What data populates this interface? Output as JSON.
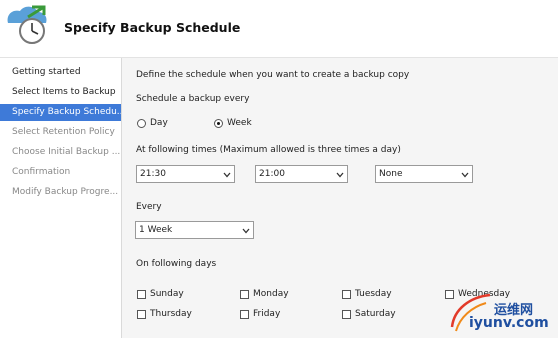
{
  "header": {
    "title": "Specify Backup Schedule"
  },
  "sidebar": {
    "items": [
      {
        "label": "Getting started",
        "state": "normal"
      },
      {
        "label": "Select Items to Backup",
        "state": "normal"
      },
      {
        "label": "Specify Backup Schedu...",
        "state": "active"
      },
      {
        "label": "Select Retention Policy",
        "state": "disabled"
      },
      {
        "label": "Choose Initial Backup ...",
        "state": "disabled"
      },
      {
        "label": "Confirmation",
        "state": "disabled"
      },
      {
        "label": "Modify Backup Progre...",
        "state": "disabled"
      }
    ]
  },
  "main": {
    "intro": "Define the schedule when you want to create a backup copy",
    "frequency_label": "Schedule a backup every",
    "frequency_options": [
      {
        "label": "Day",
        "selected": false
      },
      {
        "label": "Week",
        "selected": true
      }
    ],
    "times_label": "At following times (Maximum allowed is three times a day)",
    "times": [
      "21:30",
      "21:00",
      "None"
    ],
    "every_label": "Every",
    "every_value": "1 Week",
    "days_label": "On following days",
    "days": [
      {
        "label": "Sunday",
        "checked": false
      },
      {
        "label": "Monday",
        "checked": false
      },
      {
        "label": "Tuesday",
        "checked": false
      },
      {
        "label": "Wednesday",
        "checked": false
      },
      {
        "label": "Thursday",
        "checked": false
      },
      {
        "label": "Friday",
        "checked": false
      },
      {
        "label": "Saturday",
        "checked": false
      }
    ]
  },
  "watermark": {
    "cn_text": "运维网",
    "en_text": "iyunv.com"
  },
  "colors": {
    "active_step_bg": "#3e7ad8",
    "content_bg": "#f5f5f5",
    "watermark": "#1f4fa0"
  }
}
